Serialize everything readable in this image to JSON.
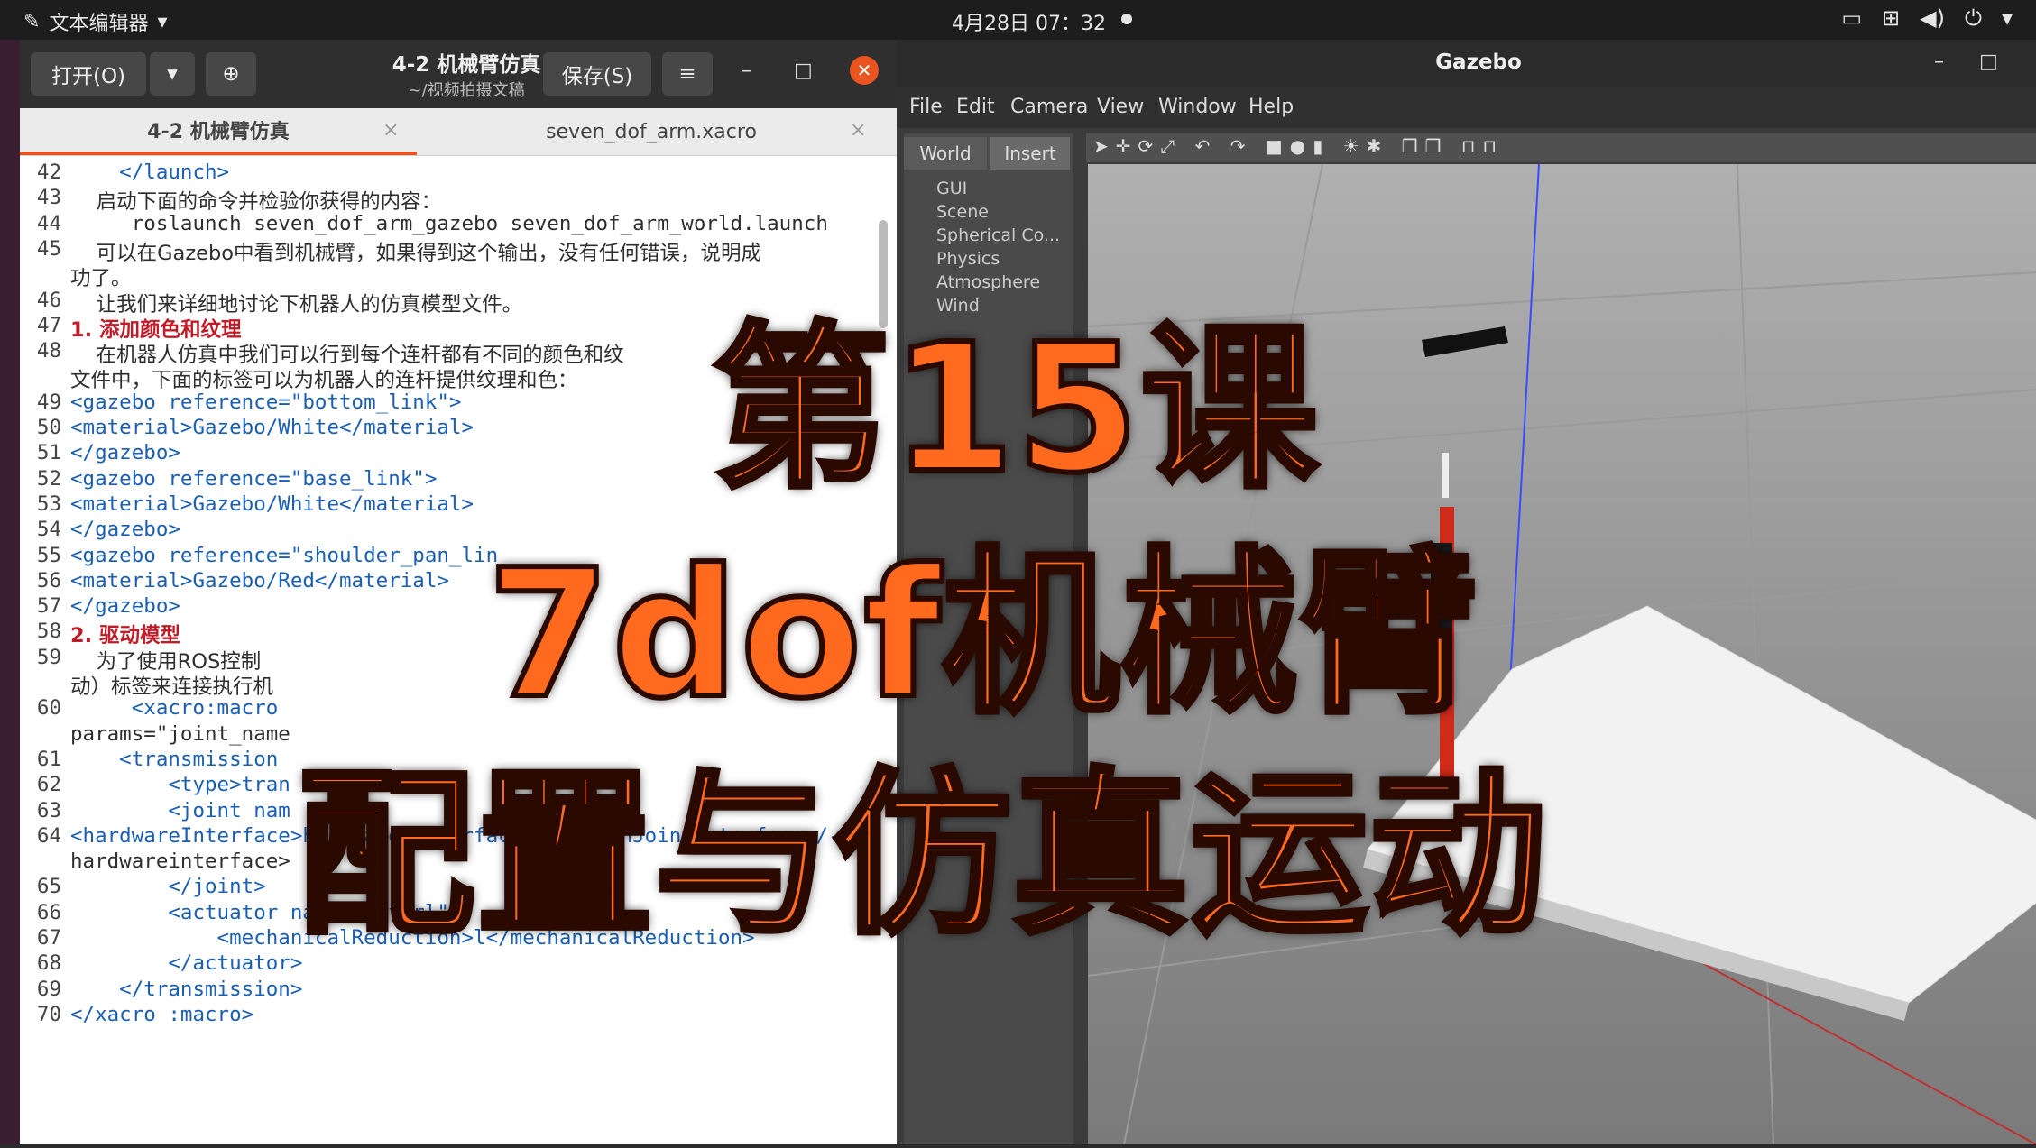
{
  "topbar": {
    "app_name": "文本编辑器",
    "clock": "4月28日 07：32"
  },
  "editor": {
    "open_label": "打开(O)",
    "save_label": "保存(S)",
    "title": "4-2 机械臂仿真",
    "subtitle": "~/视频拍摄文稿",
    "tabs": [
      {
        "label": "4-2 机械臂仿真"
      },
      {
        "label": "seven_dof_arm.xacro"
      }
    ],
    "lines": [
      {
        "n": "42",
        "t": "    </launch>"
      },
      {
        "n": "43",
        "t": "    启动下面的命令并检验你获得的内容："
      },
      {
        "n": "44",
        "t": "     roslaunch seven_dof_arm_gazebo seven_dof_arm_world.launch"
      },
      {
        "n": "45",
        "t": "    可以在Gazebo中看到机械臂，如果得到这个输出，没有任何错误，说明成"
      },
      {
        "n": "",
        "t": "功了。"
      },
      {
        "n": "46",
        "t": "    让我们来详细地讨论下机器人的仿真模型文件。"
      },
      {
        "n": "47",
        "t": "1. 添加颜色和纹理"
      },
      {
        "n": "48",
        "t": "    在机器人仿真中我们可以行到每个连杆都有不同的颜色和纹"
      },
      {
        "n": "",
        "t": "文件中，下面的标签可以为机器人的连杆提供纹理和色："
      },
      {
        "n": "49",
        "t": "<gazebo reference=\"bottom_link\">"
      },
      {
        "n": "50",
        "t": "<material>Gazebo/White</material>"
      },
      {
        "n": "51",
        "t": "</gazebo>"
      },
      {
        "n": "52",
        "t": "<gazebo reference=\"base_link\">"
      },
      {
        "n": "53",
        "t": "<material>Gazebo/White</material>"
      },
      {
        "n": "54",
        "t": "</gazebo>"
      },
      {
        "n": "55",
        "t": "<gazebo reference=\"shoulder_pan_lin"
      },
      {
        "n": "56",
        "t": "<material>Gazebo/Red</material>"
      },
      {
        "n": "57",
        "t": "</gazebo>"
      },
      {
        "n": "58",
        "t": "2. 驱动模型"
      },
      {
        "n": "59",
        "t": "    为了使用ROS控制"
      },
      {
        "n": "",
        "t": "动）标签来连接执行机"
      },
      {
        "n": "60",
        "t": "     <xacro:macro"
      },
      {
        "n": "",
        "t": "params=\"joint_name"
      },
      {
        "n": "61",
        "t": "    <transmission"
      },
      {
        "n": "62",
        "t": "        <type>tran"
      },
      {
        "n": "63",
        "t": "        <joint nam"
      },
      {
        "n": "64",
        "t": "<hardwareInterface>hardware_interface/PositionJointinterface</-"
      },
      {
        "n": "",
        "t": "hardwareinterface>"
      },
      {
        "n": "65",
        "t": "        </joint>"
      },
      {
        "n": "66",
        "t": "        <actuator name=\"motorl\">"
      },
      {
        "n": "67",
        "t": "            <mechanicalReduction>l</mechanicalReduction>"
      },
      {
        "n": "68",
        "t": "        </actuator>"
      },
      {
        "n": "69",
        "t": "    </transmission>"
      },
      {
        "n": "70",
        "t": "</xacro :macro>"
      }
    ]
  },
  "gazebo": {
    "title": "Gazebo",
    "menu": [
      "File",
      "Edit",
      "Camera",
      "View",
      "Window",
      "Help"
    ],
    "side_tabs": [
      "World",
      "Insert"
    ],
    "world_items": [
      "GUI",
      "Scene",
      "Spherical Co...",
      "Physics",
      "Atmosphere",
      "Wind"
    ]
  },
  "overlay": {
    "line1": "第15课",
    "line2": "7dof机械臂",
    "line3": "配置与仿真运动"
  },
  "colors": {
    "accent": "#e95420",
    "overlay_fill": "#ff6a1f"
  }
}
